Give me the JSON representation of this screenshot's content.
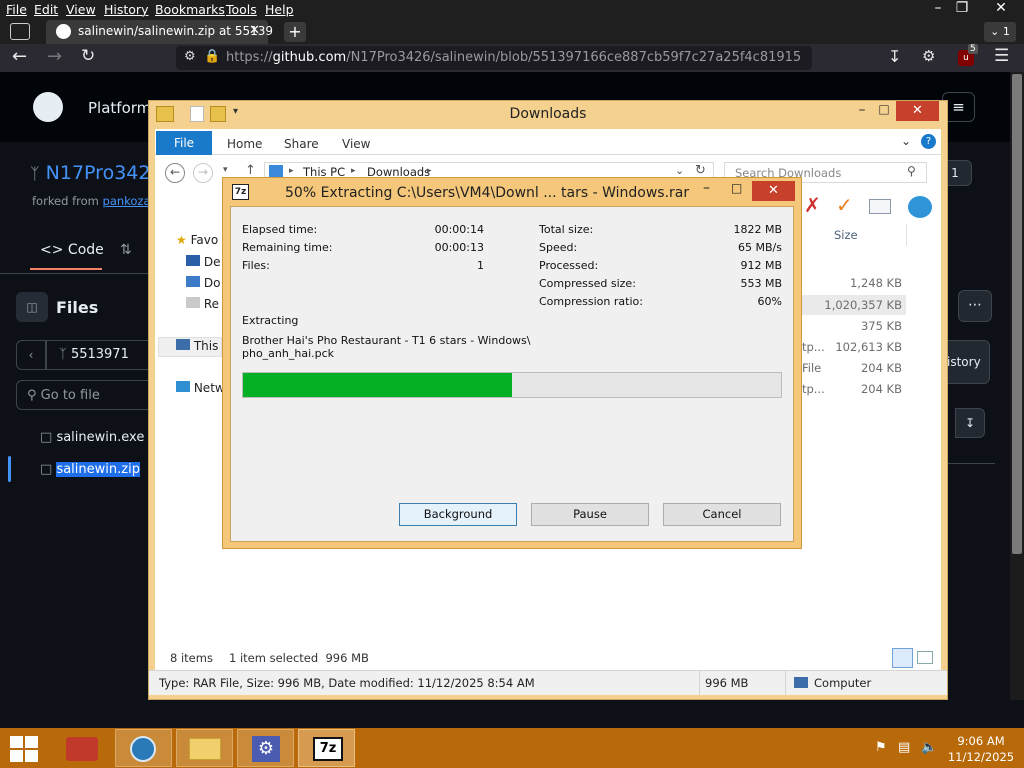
{
  "browser": {
    "menu": [
      "File",
      "Edit",
      "View",
      "History",
      "Bookmarks",
      "Tools",
      "Help"
    ],
    "tab_title": "salinewin/salinewin.zip at 55139",
    "url_prefix": "https://",
    "url_host": "github.com",
    "url_path": "/N17Pro3426/salinewin/blob/551397166ce887cb59f7c27a25f4c81915",
    "tab_count": "1",
    "ext_badge": "5"
  },
  "github": {
    "platform_label": "Platform",
    "repo_name": "N17Pro342",
    "forked_from_prefix": "forked from",
    "forked_from_link": "pankoza2",
    "code_tab": "Code",
    "files_title": "Files",
    "branch": "5513971",
    "go_to_file": "Go to file",
    "files": [
      "salinewin.exe",
      "salinewin.zip"
    ],
    "history_btn": "istory",
    "count_badge": "1"
  },
  "explorer": {
    "title": "Downloads",
    "ribbon_file": "File",
    "ribbon_tabs": [
      "Home",
      "Share",
      "View"
    ],
    "breadcrumb": [
      "This PC",
      "Downloads"
    ],
    "search_placeholder": "Search Downloads",
    "nav": [
      {
        "label": "Favo",
        "icon": "star-icon"
      },
      {
        "label": "De",
        "icon": "desktop-icon"
      },
      {
        "label": "Do",
        "icon": "downloads-icon"
      },
      {
        "label": "Re",
        "icon": "recent-icon"
      },
      {
        "label": "This",
        "icon": "computer-icon"
      },
      {
        "label": "Netw",
        "icon": "network-icon"
      }
    ],
    "column_size": "Size",
    "rows": [
      {
        "type": "",
        "size": "1,248 KB"
      },
      {
        "type": "",
        "size": "1,020,357 KB"
      },
      {
        "type": "",
        "size": "375 KB"
      },
      {
        "type": "tp...",
        "size": "102,613 KB"
      },
      {
        "type": "File",
        "size": "204 KB"
      },
      {
        "type": "tp...",
        "size": "204 KB"
      }
    ],
    "status_items": "8 items",
    "status_selected": "1 item selected  996 MB",
    "details_type": "Type: RAR File, Size: 996 MB, Date modified: 11/12/2025 8:54 AM",
    "details_size": "996 MB",
    "details_location": "Computer"
  },
  "dialog": {
    "title": "50% Extracting C:\\Users\\VM4\\Downl ... tars - Windows.rar",
    "icon_text": "7z",
    "left_stats": [
      {
        "label": "Elapsed time:",
        "value": "00:00:14"
      },
      {
        "label": "Remaining time:",
        "value": "00:00:13"
      },
      {
        "label": "Files:",
        "value": "1"
      }
    ],
    "right_stats": [
      {
        "label": "Total size:",
        "value": "1822 MB"
      },
      {
        "label": "Speed:",
        "value": "65 MB/s"
      },
      {
        "label": "Processed:",
        "value": "912 MB"
      },
      {
        "label": "Compressed size:",
        "value": "553 MB"
      },
      {
        "label": "Compression ratio:",
        "value": "60%"
      }
    ],
    "operation": "Extracting",
    "current_path_line1": "Brother Hai's Pho Restaurant - T1 6 stars - Windows\\",
    "current_path_line2": "pho_anh_hai.pck",
    "progress": 0.5,
    "buttons": {
      "background": "Background",
      "pause": "Pause",
      "cancel": "Cancel"
    }
  },
  "taskbar": {
    "time": "9:06 AM",
    "date": "11/12/2025"
  },
  "colors": {
    "accent_blue": "#1979ca",
    "progress_green": "#06b025",
    "taskbar_orange": "#b86a0a",
    "window_frame": "#f4d18e"
  }
}
